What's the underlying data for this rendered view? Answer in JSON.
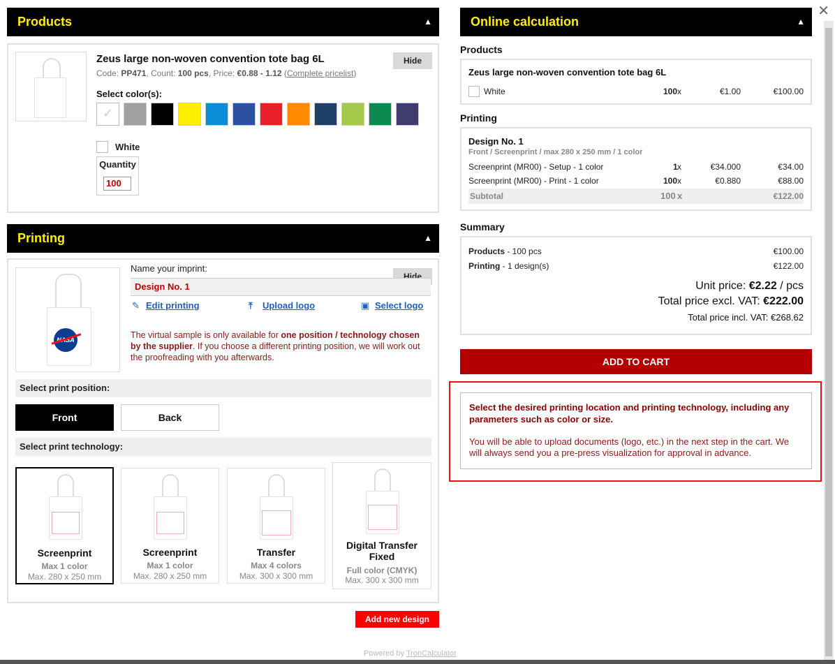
{
  "close_label": "✕",
  "products_section": {
    "title": "Products",
    "product": {
      "name": "Zeus large non-woven convention tote bag 6L",
      "code_label": "Code:",
      "code": "PP471",
      "count_label": "Count:",
      "count": "100 pcs",
      "price_label": "Price:",
      "price_range": "€0.88 - 1.12",
      "pricelist_link": "Complete pricelist",
      "hide_label": "Hide",
      "select_colors_label": "Select color(s):",
      "colors": [
        "#ffffff",
        "#a0a0a0",
        "#000000",
        "#ffee00",
        "#0a8fd6",
        "#2d50a0",
        "#e8202a",
        "#ff8a00",
        "#1e3f66",
        "#a3c84a",
        "#0a8a50",
        "#3f3d70"
      ],
      "selected_color": "White",
      "quantity_label": "Quantity",
      "quantity_value": "100"
    }
  },
  "printing_section": {
    "title": "Printing",
    "imprint_label": "Name your imprint:",
    "hide_label": "Hide",
    "imprint_name": "Design No. 1",
    "edit_link": "Edit printing",
    "upload_link": "Upload logo",
    "select_link": "Select logo",
    "note_part1": "The virtual sample is only available for ",
    "note_bold": "one position / technology chosen by the supplier",
    "note_part2": ". If you choose a different printing position, we will work out the proofreading with you afterwards.",
    "position_label": "Select print position:",
    "positions": [
      "Front",
      "Back"
    ],
    "selected_position": "Front",
    "technology_label": "Select print technology:",
    "technologies": [
      {
        "name": "Screenprint",
        "sub": "Max 1 color",
        "dim": "Max. 280 x 250 mm",
        "selected": true
      },
      {
        "name": "Screenprint",
        "sub": "Max 1 color",
        "dim": "Max. 280 x 250 mm",
        "selected": false
      },
      {
        "name": "Transfer",
        "sub": "Max 4 colors",
        "dim": "Max. 300 x 300 mm",
        "selected": false
      },
      {
        "name": "Digital Transfer Fixed",
        "sub": "Full color (CMYK)",
        "dim": "Max. 300 x 300 mm",
        "selected": false
      }
    ],
    "add_design_label": "Add new design",
    "logo_text": "NASA"
  },
  "powered_by": {
    "prefix": "Powered by ",
    "link": "TronCalculator"
  },
  "calculation": {
    "title": "Online calculation",
    "products_title": "Products",
    "product_name": "Zeus large non-woven convention tote bag 6L",
    "product_line": {
      "color": "White",
      "qty": "100",
      "qty_suffix": "x",
      "unit": "€1.00",
      "total": "€100.00"
    },
    "printing_title": "Printing",
    "design_name": "Design No. 1",
    "design_meta": "Front / Screenprint / max 280 x 250 mm / 1 color",
    "print_lines": [
      {
        "label": "Screenprint (MR00) - Setup - 1 color",
        "qty": "1",
        "unit": "€34.000",
        "total": "€34.00"
      },
      {
        "label": "Screenprint (MR00) - Print - 1 color",
        "qty": "100",
        "unit": "€0.880",
        "total": "€88.00"
      }
    ],
    "subtotal_label": "Subtotal",
    "subtotal_qty": "100",
    "subtotal_total": "€122.00",
    "summary_title": "Summary",
    "summary_products_label": "Products",
    "summary_products_detail": " - 100 pcs",
    "summary_products_value": "€100.00",
    "summary_printing_label": "Printing",
    "summary_printing_detail": " - 1 design(s)",
    "summary_printing_value": "€122.00",
    "unit_price_label": "Unit price: ",
    "unit_price_value": "€2.22",
    "unit_price_suffix": " / pcs",
    "total_excl_label": "Total price excl. VAT: ",
    "total_excl_value": "€222.00",
    "total_incl_label": "Total price incl. VAT: ",
    "total_incl_value": "€268.62",
    "add_to_cart_label": "ADD TO CART",
    "hint_bold": "Select the desired printing location and printing technology, including any parameters such as color or size.",
    "hint_text": "You will be able to upload documents (logo, etc.) in the next step in the cart. We will always send you a pre-press visualization for approval in advance."
  }
}
